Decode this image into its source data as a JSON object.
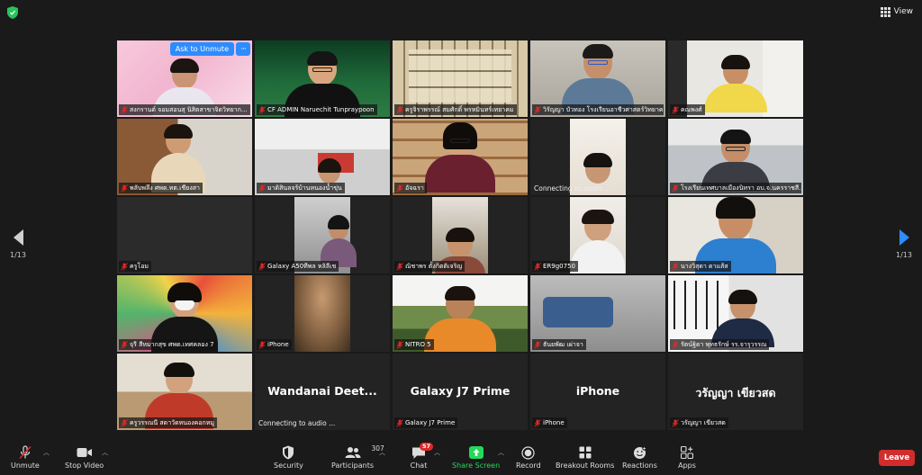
{
  "top": {
    "view_label": "View"
  },
  "pagination": {
    "left": "1/13",
    "right": "1/13"
  },
  "tiles": [
    {
      "name": "สงกรานต์ จอมสอนสุ นิสิตสาขาจิตวิทยาก...",
      "popup": {
        "ask": "Ask to Unmute",
        "more": "···"
      }
    },
    {
      "name": "CF ADMIN Naruechit Tunpraypoon"
    },
    {
      "name": "ครูจิราพรรณ์ สมศักดิ์ พรหมินทร์เทยาคม"
    },
    {
      "name": "วิรัญญา บัวทอง โรงเรียนอาชีวศาสตร์วิทยาคาร"
    },
    {
      "name": "คณพงศ์"
    },
    {
      "name": "พลับพลึง ศพด.ทต.เชียงสา"
    },
    {
      "name": "มาดิสินลจร้บ้านหนองน้ำขุ่น"
    },
    {
      "name": "อัจฉรา"
    },
    {
      "name": "",
      "status": "Connecting to audio ..."
    },
    {
      "name": "โรงเรียนเทศบาลเมืองนิทรา อบ.จ.นครราชสี..."
    },
    {
      "name": "ครูโอม"
    },
    {
      "name": "Galaxy A50ทีพล หลิลีเช"
    },
    {
      "name": "ณิชาพร ตั้งกิตติเจริญ"
    },
    {
      "name": "ER9g0750"
    },
    {
      "name": "นางวิสุดา ดาแส้ส"
    },
    {
      "name": "จุรี สีหมากสุข ศพด.เทศคลอง 7"
    },
    {
      "name": "iPhone"
    },
    {
      "name": "NITRO 5"
    },
    {
      "name": "ธันยพัฒ เผ่าจา"
    },
    {
      "name": "รัตน์ฐิดา พุทธรักษ์ รร.จารุวรรณ"
    },
    {
      "name": "ครูวรรณนี สดาวัดหนองคอกหมู"
    },
    {
      "name": "",
      "display": "Wandanai  Deet...",
      "status": "Connecting to audio ..."
    },
    {
      "name": "Galaxy J7 Prime",
      "display": "Galaxy J7 Prime"
    },
    {
      "name": "iPhone",
      "display": "iPhone"
    },
    {
      "name": "วรัญญา เขียวสด",
      "display": "วรัญญา เขียวสด"
    }
  ],
  "toolbar": {
    "unmute": "Unmute",
    "stop_video": "Stop Video",
    "security": "Security",
    "participants": "Participants",
    "participants_count": "307",
    "chat": "Chat",
    "chat_badge": "57",
    "share": "Share Screen",
    "record": "Record",
    "breakout": "Breakout Rooms",
    "reactions": "Reactions",
    "apps": "Apps",
    "leave": "Leave"
  },
  "colors": {
    "accent": "#2d8cff",
    "share": "#23d959",
    "leave": "#d12d2d",
    "muted": "#e02828"
  }
}
